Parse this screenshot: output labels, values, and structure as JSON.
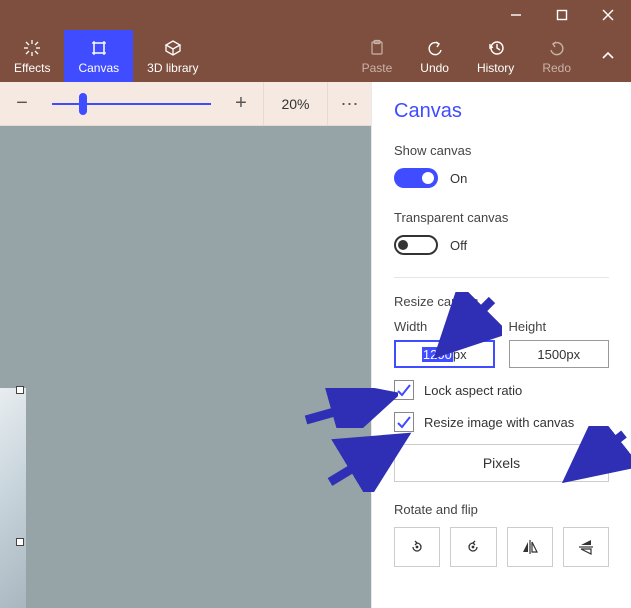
{
  "titlebar": {
    "min": "minimize",
    "max": "maximize",
    "close": "close"
  },
  "ribbon": {
    "effects": "Effects",
    "canvas": "Canvas",
    "library": "3D library",
    "paste": "Paste",
    "undo": "Undo",
    "history": "History",
    "redo": "Redo"
  },
  "zoom": {
    "percent": "20%"
  },
  "panel": {
    "title": "Canvas",
    "show_canvas": "Show canvas",
    "show_canvas_state": "On",
    "transparent": "Transparent canvas",
    "transparent_state": "Off",
    "resize": "Resize canvas",
    "width_label": "Width",
    "height_label": "Height",
    "width_value": "1200",
    "height_value": "1500",
    "unit_suffix": "px",
    "lock": "Lock aspect ratio",
    "resize_img": "Resize image with canvas",
    "units": "Pixels",
    "rotate": "Rotate and flip"
  }
}
